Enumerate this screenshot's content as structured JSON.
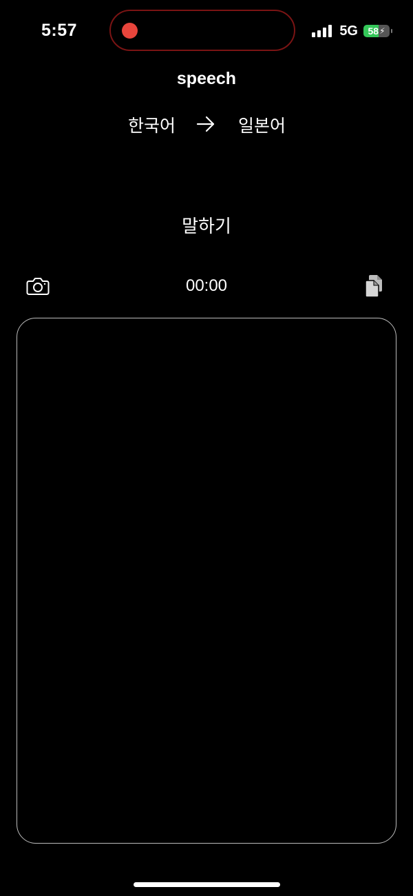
{
  "status_bar": {
    "time": "5:57",
    "network": "5G",
    "battery_percent": "58",
    "battery_level": 0.58,
    "signal_bars": 4,
    "recording_indicator_color": "#e8453c",
    "battery_color": "#34c759"
  },
  "header": {
    "title": "speech"
  },
  "languages": {
    "source": "한국어",
    "target": "일본어",
    "arrow_icon": "arrow-right-icon"
  },
  "speak_button": {
    "label": "말하기"
  },
  "toolbar": {
    "camera_icon": "camera-icon",
    "timer": "00:00",
    "copy_icon": "copy-icon"
  },
  "transcript": {
    "text": ""
  }
}
